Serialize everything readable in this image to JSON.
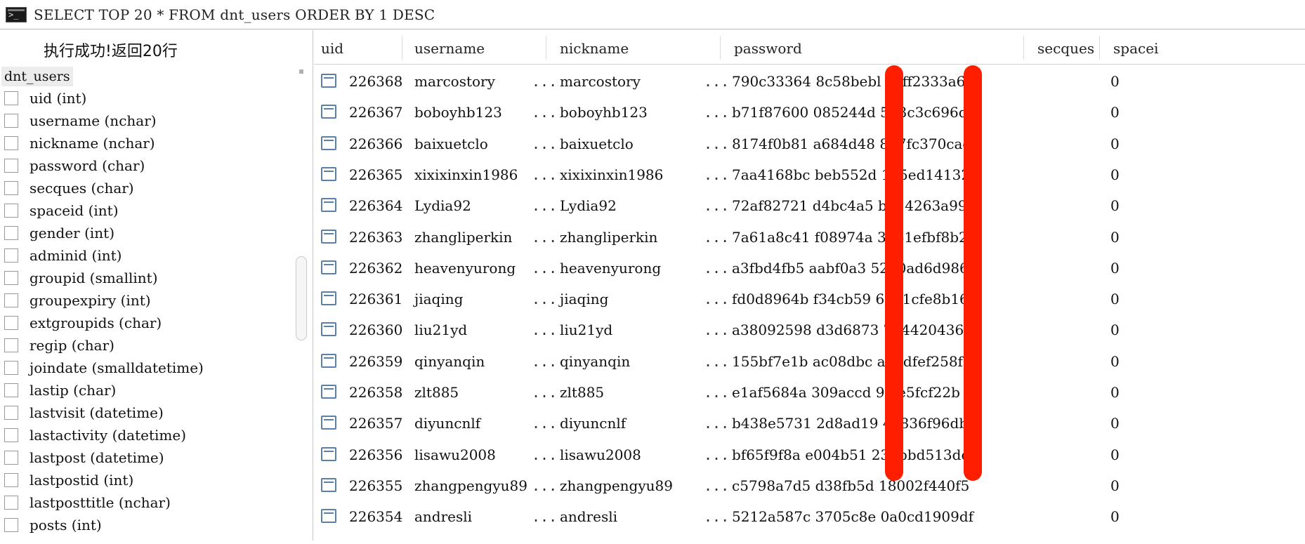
{
  "command": {
    "query": "SELECT TOP 20 * FROM dnt_users ORDER BY 1 DESC"
  },
  "left_panel": {
    "status": "执行成功!返回20行",
    "table_name": "dnt_users",
    "columns": [
      "uid (int)",
      "username (nchar)",
      "nickname (nchar)",
      "password (char)",
      "secques (char)",
      "spaceid (int)",
      "gender (int)",
      "adminid (int)",
      "groupid (smallint)",
      "groupexpiry (int)",
      "extgroupids (char)",
      "regip (char)",
      "joindate (smalldatetime)",
      "lastip (char)",
      "lastvisit (datetime)",
      "lastactivity (datetime)",
      "lastpost (datetime)",
      "lastpostid (int)",
      "lastposttitle (nchar)",
      "posts (int)"
    ]
  },
  "grid": {
    "headers": {
      "uid": "uid",
      "username": "username",
      "nickname": "nickname",
      "password": "password",
      "secques": "secques",
      "spaceid": "spacei"
    },
    "ellipsis": "...",
    "rows": [
      {
        "uid": "226368",
        "username": "marcostory",
        "nickname": "marcostory",
        "password": "790c33364 8c58bebl eeff2333a67",
        "secques": "0"
      },
      {
        "uid": "226367",
        "username": "boboyhb123",
        "nickname": "boboyhb123",
        "password": "b71f87600 085244d 5b3c3c696d8",
        "secques": "0"
      },
      {
        "uid": "226366",
        "username": "baixuetclo",
        "nickname": "baixuetclo",
        "password": "8174f0b81 a684d48 807fc370cad",
        "secques": "0"
      },
      {
        "uid": "226365",
        "username": "xixixinxin1986",
        "nickname": "xixixinxin1986",
        "password": "7aa4168bc beb552d 185ed141329",
        "secques": "0"
      },
      {
        "uid": "226364",
        "username": "Lydia92",
        "nickname": "Lydia92",
        "password": "72af82721 d4bc4a5 b514263a999",
        "secques": "0"
      },
      {
        "uid": "226363",
        "username": "zhangliperkin",
        "nickname": "zhangliperkin",
        "password": "7a61a8c41 f08974a 33b1efbf8b2",
        "secques": "0"
      },
      {
        "uid": "226362",
        "username": "heavenyurong",
        "nickname": "heavenyurong",
        "password": "a3fbd4fb5 aabf0a3 5220ad6d986",
        "secques": "0"
      },
      {
        "uid": "226361",
        "username": "jiaqing",
        "nickname": "jiaqing",
        "password": "fd0d8964b f34cb59 6291cfe8b16",
        "secques": "0"
      },
      {
        "uid": "226360",
        "username": "liu21yd",
        "nickname": "liu21yd",
        "password": "a38092598 d3d6873 7944204361f",
        "secques": "0"
      },
      {
        "uid": "226359",
        "username": "qinyanqin",
        "nickname": "qinyanqin",
        "password": "155bf7e1b ac08dbc a99dfef258f",
        "secques": "0"
      },
      {
        "uid": "226358",
        "username": "zlt885",
        "nickname": "zlt885",
        "password": "e1af5684a 309accd 9fce5fcf22b",
        "secques": "0"
      },
      {
        "uid": "226357",
        "username": "diyuncnlf",
        "nickname": "diyuncnlf",
        "password": "b438e5731 2d8ad19 4a836f96db6",
        "secques": "0"
      },
      {
        "uid": "226356",
        "username": "lisawu2008",
        "nickname": "lisawu2008",
        "password": "bf65f9f8a e004b51 23bbbd513de",
        "secques": "0"
      },
      {
        "uid": "226355",
        "username": "zhangpengyu89",
        "nickname": "zhangpengyu89",
        "password": "c5798a7d5 d38fb5d 18002f440f5",
        "secques": "0"
      },
      {
        "uid": "226354",
        "username": "andresli",
        "nickname": "andresli",
        "password": "5212a587c 3705c8e 0a0cd1909df",
        "secques": "0"
      }
    ]
  },
  "colors": {
    "redaction": "#ff1e00",
    "row_icon": "#5a7fa8"
  }
}
